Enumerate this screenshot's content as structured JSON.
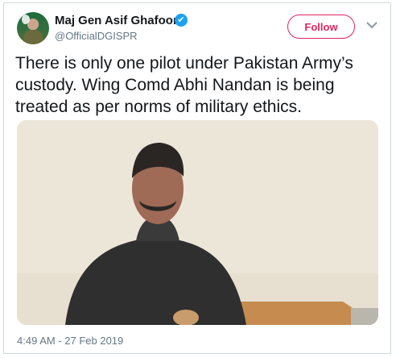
{
  "tweet": {
    "author_name": "Maj Gen Asif Ghafoor",
    "handle": "@OfficialDGISPR",
    "follow_label": "Follow",
    "verified_symbol": "✔",
    "text": "There is only one pilot under Pakistan Army’s custody. Wing Comd Abhi Nandan is being treated as per norms of military ethics.",
    "timestamp": "4:49 AM - 27 Feb 2019"
  },
  "icons": {
    "verified": "verified-badge-icon",
    "menu": "chevron-down-icon"
  },
  "colors": {
    "follow_accent": "#e0245e",
    "verified_blue": "#1da1f2",
    "text_primary": "#14171a",
    "text_secondary": "#657786"
  }
}
